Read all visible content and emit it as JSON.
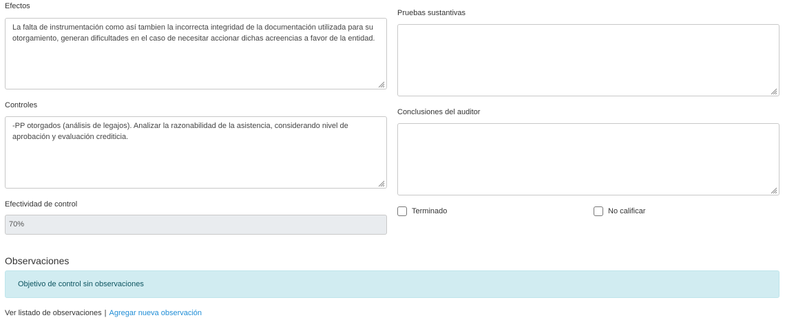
{
  "left": {
    "efectos": {
      "label": "Efectos",
      "value": "La falta de instrumentación como así tambien la incorrecta integridad de la documentación utilizada para su otorgamiento, generan dificultades en el caso de necesitar accionar dichas acreencias a favor de la entidad."
    },
    "controles": {
      "label": "Controles",
      "value": "-PP otorgados (análisis de legajos). Analizar la razonabilidad de la asistencia, considerando nivel de aprobación y evaluación crediticia."
    },
    "efectividad": {
      "label": "Efectividad de control",
      "value": "70%"
    }
  },
  "right": {
    "pruebas": {
      "label": "Pruebas sustantivas",
      "value": ""
    },
    "conclusiones": {
      "label": "Conclusiones del auditor",
      "value": ""
    },
    "terminado": {
      "label": "Terminado",
      "checked": false
    },
    "no_calificar": {
      "label": "No calificar",
      "checked": false
    }
  },
  "observaciones": {
    "title": "Observaciones",
    "alert_text": "Objetivo de control sin observaciones",
    "list_link": "Ver listado de observaciones",
    "separator": "|",
    "add_link": "Agregar nueva observación"
  },
  "colors": {
    "alert_bg": "#d1ecf1",
    "alert_text": "#0c5460",
    "link": "#1f8dd6",
    "readonly_bg": "#e9ecef"
  },
  "icons": {
    "resize_grip": "resize-grip-icon"
  }
}
